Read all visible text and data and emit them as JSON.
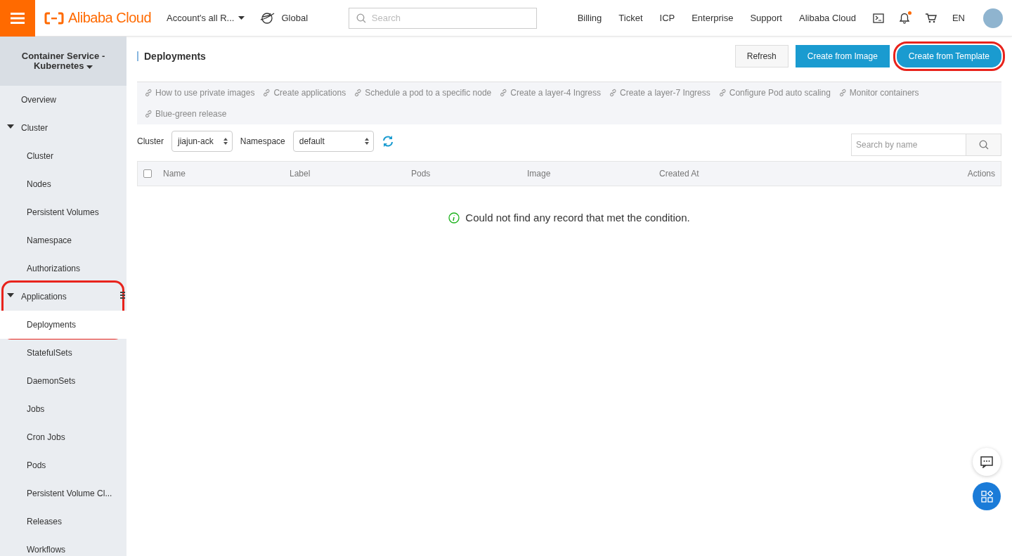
{
  "topbar": {
    "logo": "Alibaba Cloud",
    "account": "Account's all R...",
    "region": "Global",
    "search": {
      "placeholder": "Search"
    },
    "links": [
      "Billing",
      "Ticket",
      "ICP",
      "Enterprise",
      "Support",
      "Alibaba Cloud"
    ],
    "notification_dot": true,
    "language": "EN"
  },
  "sidebar": {
    "title": "Container Service - Kubernetes",
    "items": [
      {
        "label": "Overview",
        "selected": false,
        "highlighted": false
      },
      {
        "label": "Cluster",
        "expanded": true,
        "selected": false,
        "highlighted": false,
        "children": [
          {
            "label": "Cluster",
            "selected": false
          },
          {
            "label": "Nodes",
            "selected": false
          },
          {
            "label": "Persistent Volumes",
            "selected": false
          },
          {
            "label": "Namespace",
            "selected": false
          },
          {
            "label": "Authorizations",
            "selected": false
          }
        ]
      },
      {
        "label": "Applications",
        "expanded": true,
        "selected": false,
        "highlighted": true,
        "children": [
          {
            "label": "Deployments",
            "selected": true
          },
          {
            "label": "StatefulSets",
            "selected": false
          },
          {
            "label": "DaemonSets",
            "selected": false
          },
          {
            "label": "Jobs",
            "selected": false
          },
          {
            "label": "Cron Jobs",
            "selected": false
          },
          {
            "label": "Pods",
            "selected": false
          },
          {
            "label": "Persistent Volume Cl...",
            "selected": false
          },
          {
            "label": "Releases",
            "selected": false
          },
          {
            "label": "Workflows",
            "selected": false
          }
        ]
      }
    ]
  },
  "page": {
    "title": "Deployments",
    "buttons": [
      {
        "label": "Refresh",
        "kind": "default",
        "highlighted": false
      },
      {
        "label": "Create from Image",
        "kind": "primary",
        "highlighted": false
      },
      {
        "label": "Create from Template",
        "kind": "primary",
        "highlighted": true
      }
    ],
    "help_links": [
      "How to use private images",
      "Create applications",
      "Schedule a pod to a specific node",
      "Create a layer-4 Ingress",
      "Create a layer-7 Ingress",
      "Configure Pod auto scaling",
      "Monitor containers",
      "Blue-green release"
    ],
    "filters": [
      {
        "label": "Cluster",
        "value": "jiajun-ack"
      },
      {
        "label": "Namespace",
        "value": "default"
      }
    ],
    "name_search": {
      "placeholder": "Search by name"
    },
    "table": {
      "select_all_checked": false,
      "columns": [
        "Name",
        "Label",
        "Pods",
        "Image",
        "Created At",
        "Actions"
      ]
    },
    "empty_message": "Could not find any record that met the condition."
  }
}
